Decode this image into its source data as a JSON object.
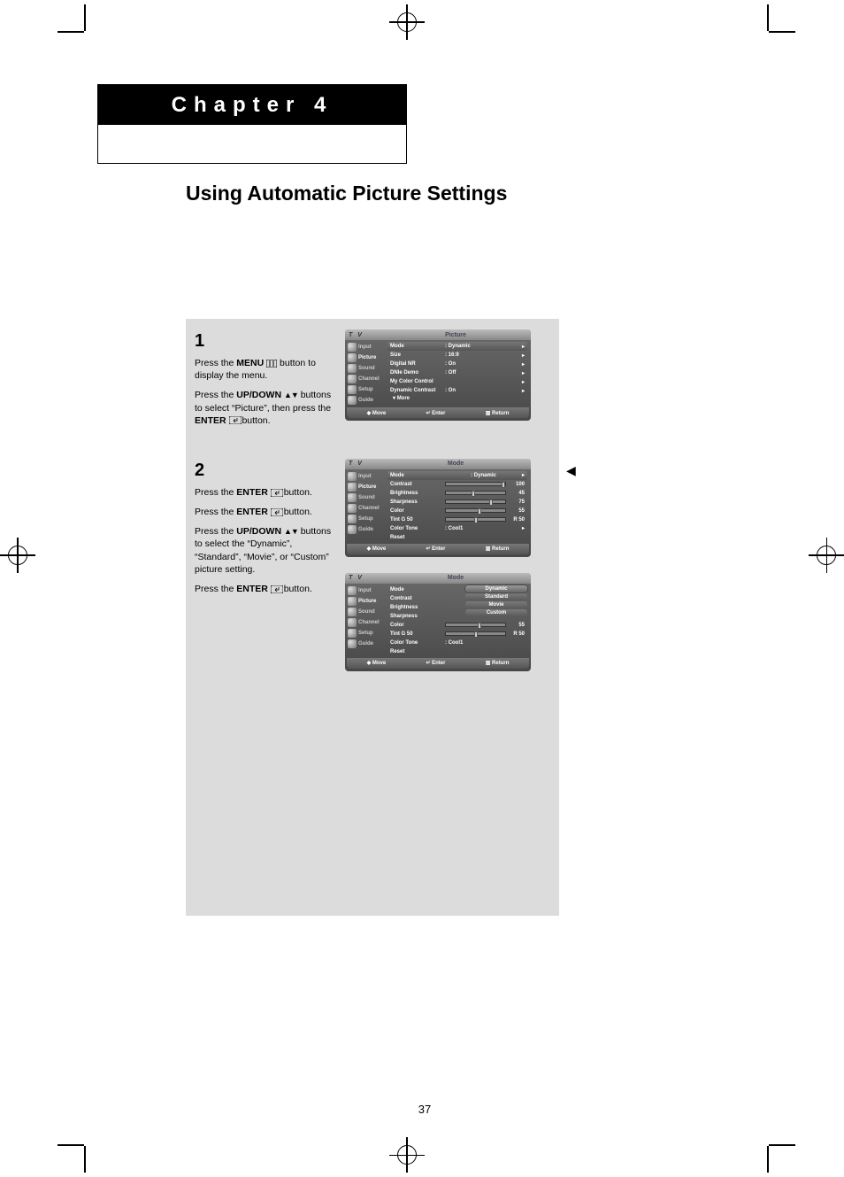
{
  "chapter_label": "Chapter 4",
  "page_title": "Using Automatic Picture Settings",
  "page_number": "37",
  "step1": {
    "num": "1",
    "p1a": "Press the ",
    "p1b": "MENU",
    "p1c": " button to display the menu.",
    "p2a": "Press the ",
    "p2b": "UP/DOWN",
    "p2c": " buttons to select “Picture”, then press the ",
    "p2d": "ENTER",
    "p2e": " button."
  },
  "step2": {
    "num": "2",
    "p1a": "Press the ",
    "p1b": "ENTER",
    "p1c": " button.",
    "p2a": "Press the ",
    "p2b": "ENTER",
    "p2c": " button.",
    "p3a": "Press the ",
    "p3b": "UP/DOWN",
    "p3c": " buttons to select the “Dynamic”, “Standard”, “Movie”, or “Custom” picture setting.",
    "p4a": "Press the ",
    "p4b": "ENTER",
    "p4c": " button."
  },
  "osd_side": {
    "i0": "Input",
    "i1": "Picture",
    "i2": "Sound",
    "i3": "Channel",
    "i4": "Setup",
    "i5": "Guide"
  },
  "osd_labels": {
    "tv": "T V"
  },
  "osd_foot": {
    "move": "Move",
    "enter": "Enter",
    "return": "Return"
  },
  "osd1": {
    "title": "Picture",
    "r0l": "Mode",
    "r0v": ": Dynamic",
    "r1l": "Size",
    "r1v": ": 16:9",
    "r2l": "Digital NR",
    "r2v": ": On",
    "r3l": "DNIe Demo",
    "r3v": ": Off",
    "r4l": "My Color Control",
    "r4v": "",
    "r5l": "Dynamic Contrast",
    "r5v": ": On",
    "more": "More"
  },
  "osd2": {
    "title": "Mode",
    "r0l": "Mode",
    "r0v": ": Dynamic",
    "r1l": "Contrast",
    "r1n": "100",
    "r1p": 100,
    "r2l": "Brightness",
    "r2n": "45",
    "r2p": 45,
    "r3l": "Sharpness",
    "r3n": "75",
    "r3p": 75,
    "r4l": "Color",
    "r4n": "55",
    "r4p": 55,
    "r5l": "Tint  G 50",
    "r5n": "R 50",
    "r5p": 50,
    "r6l": "Color Tone",
    "r6v": ": Cool1",
    "r7l": "Reset"
  },
  "osd3": {
    "title": "Mode",
    "r0l": "Mode",
    "opt0": "Dynamic",
    "opt1": "Standard",
    "opt2": "Movie",
    "opt3": "Custom",
    "r1l": "Contrast",
    "r2l": "Brightness",
    "r3l": "Sharpness",
    "r4l": "Color",
    "r4n": "55",
    "r4p": 55,
    "r5l": "Tint  G 50",
    "r5n": "R 50",
    "r5p": 50,
    "r6l": "Color Tone",
    "r6v": ": Cool1",
    "r7l": "Reset"
  }
}
